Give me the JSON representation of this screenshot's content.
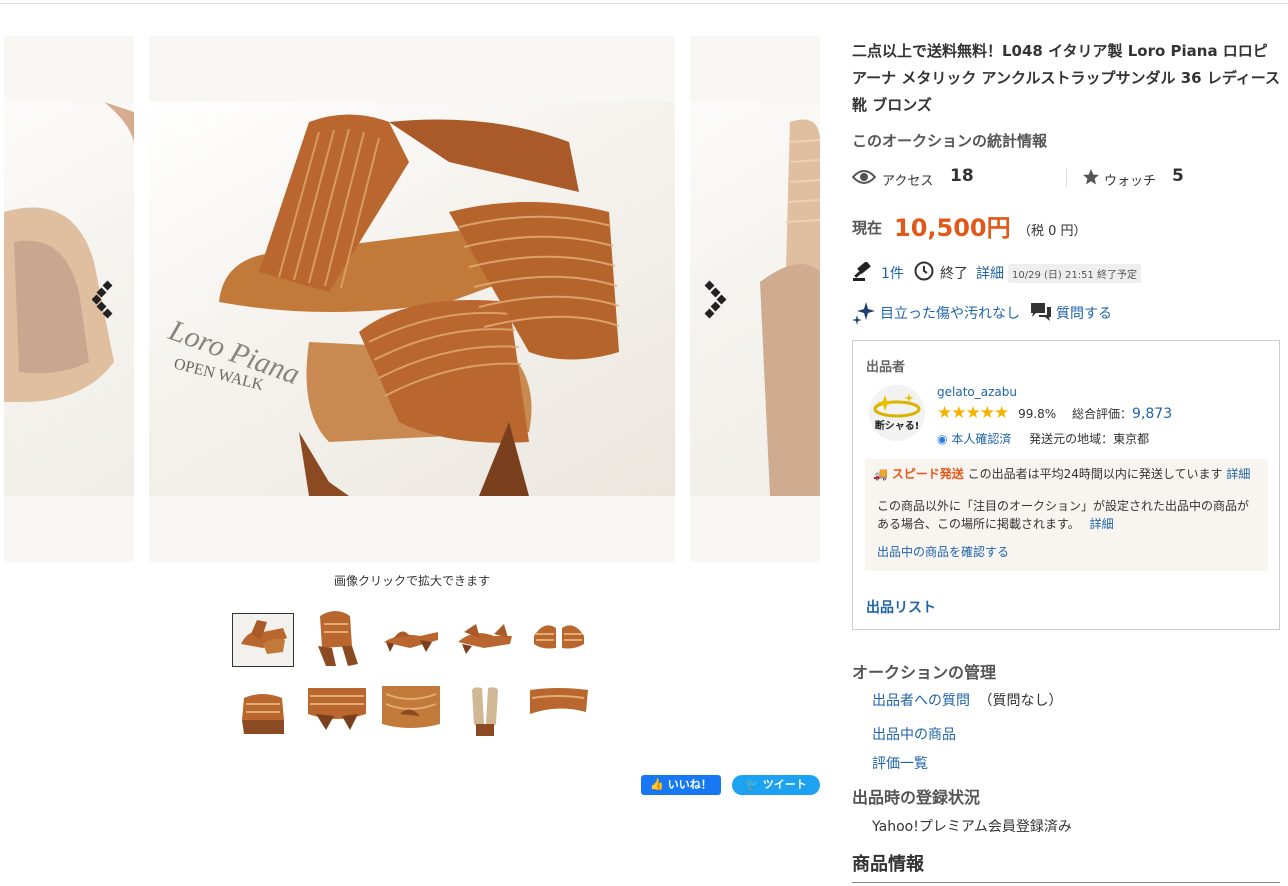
{
  "title": "二点以上で送料無料！L048 イタリア製 Loro Piana ロロピアーナ メタリック アンクルストラップサンダル 36 レディース 靴 ブロンズ",
  "gallery": {
    "zoom_hint": "画像クリックで拡大できます",
    "thumbnail_count": 10,
    "selected_index": 0,
    "photo_brand_text": "Loro Piana",
    "photo_sub_text": "OPEN WALK"
  },
  "social": {
    "like_label": "いいね！",
    "tweet_label": "ツイート"
  },
  "stats": {
    "heading": "このオークションの統計情報",
    "access_label": "アクセス",
    "access_value": "18",
    "watch_label": "ウォッチ",
    "watch_value": "5"
  },
  "price": {
    "label": "現在",
    "value": "10,500円",
    "tax": "（税 0 円）"
  },
  "bids": {
    "count": "1件",
    "end_label": "終了",
    "detail_link": "詳細",
    "end_time": "10/29 (日) 21:51 終了予定"
  },
  "condition": {
    "label": "目立った傷や汚れなし",
    "question_label": "質問する"
  },
  "seller": {
    "heading": "出品者",
    "avatar_text": "断シャる!",
    "name": "gelato_azabu",
    "rating_stars": 5,
    "rating_percent": "99.8%",
    "total_label": "総合評価：",
    "total_value": "9,873",
    "verified_label": "本人確認済",
    "ship_from": "発送元の地域：東京都",
    "speed_label": "スピード発送",
    "speed_text": "この出品者は平均24時間以内に発送しています",
    "speed_detail": "詳細",
    "featured_text": "この商品以外に「注目のオークション」が設定された出品中の商品がある場合、この場所に掲載されます。",
    "featured_detail": "詳細",
    "listing_link": "出品中の商品を確認する",
    "seller_list": "出品リスト"
  },
  "management": {
    "heading": "オークションの管理",
    "question_link": "出品者への質問",
    "question_note": "（質問なし）",
    "listing_link": "出品中の商品",
    "ratings_link": "評価一覧"
  },
  "registration": {
    "heading": "出品時の登録状況",
    "value": "Yahoo!プレミアム会員登録済み"
  },
  "product_info": {
    "heading": "商品情報"
  },
  "colors": {
    "price": "#e0591a",
    "link": "#1f63a8",
    "bronze": "#b8632c"
  }
}
